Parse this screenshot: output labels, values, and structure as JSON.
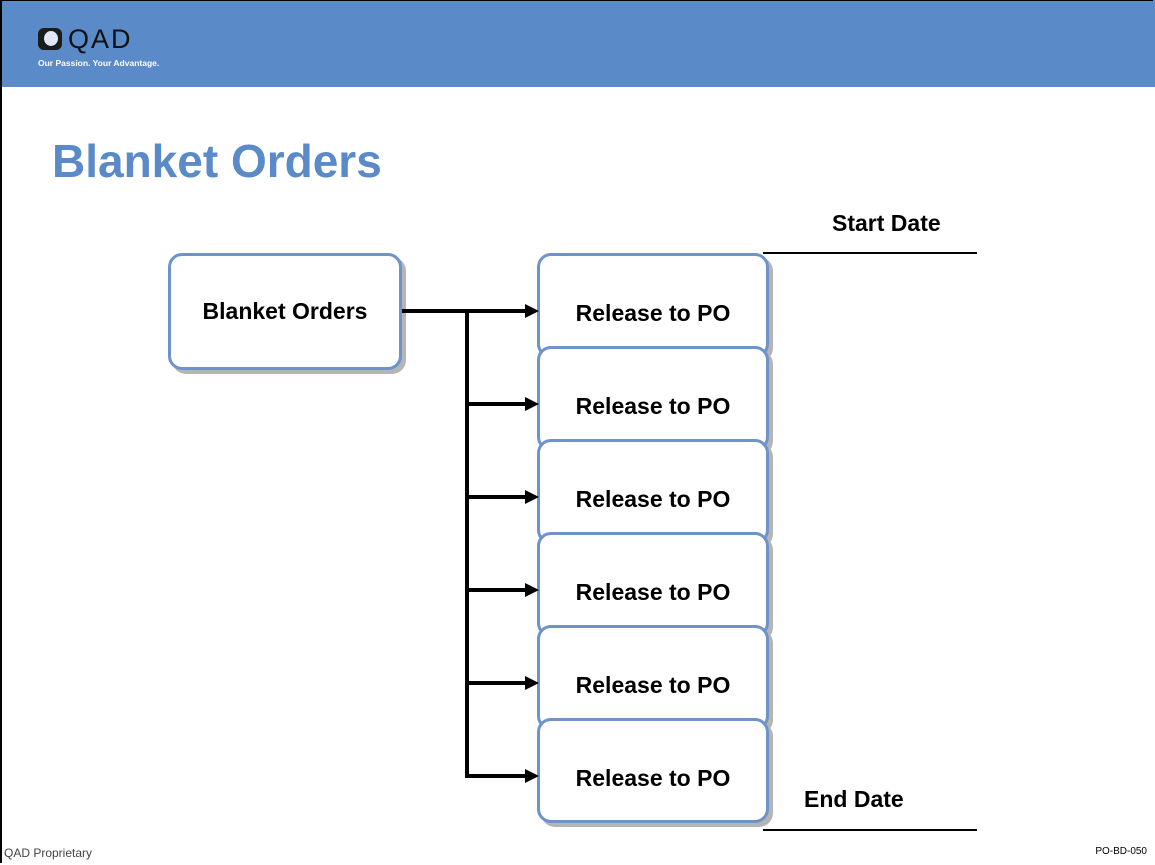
{
  "brand": {
    "logo_text": "QAD",
    "tagline": "Our Passion. Your Advantage.",
    "header_color": "#5b8ac8"
  },
  "title": "Blanket Orders",
  "diagram": {
    "source_node": "Blanket Orders",
    "release_nodes": [
      "Release to PO",
      "Release to PO",
      "Release to PO",
      "Release to PO",
      "Release to PO",
      "Release to PO"
    ],
    "start_label": "Start Date",
    "end_label": "End Date",
    "box_border_color": "#6e93c9"
  },
  "footer": {
    "left": "QAD Proprietary",
    "right": "PO-BD-050"
  }
}
